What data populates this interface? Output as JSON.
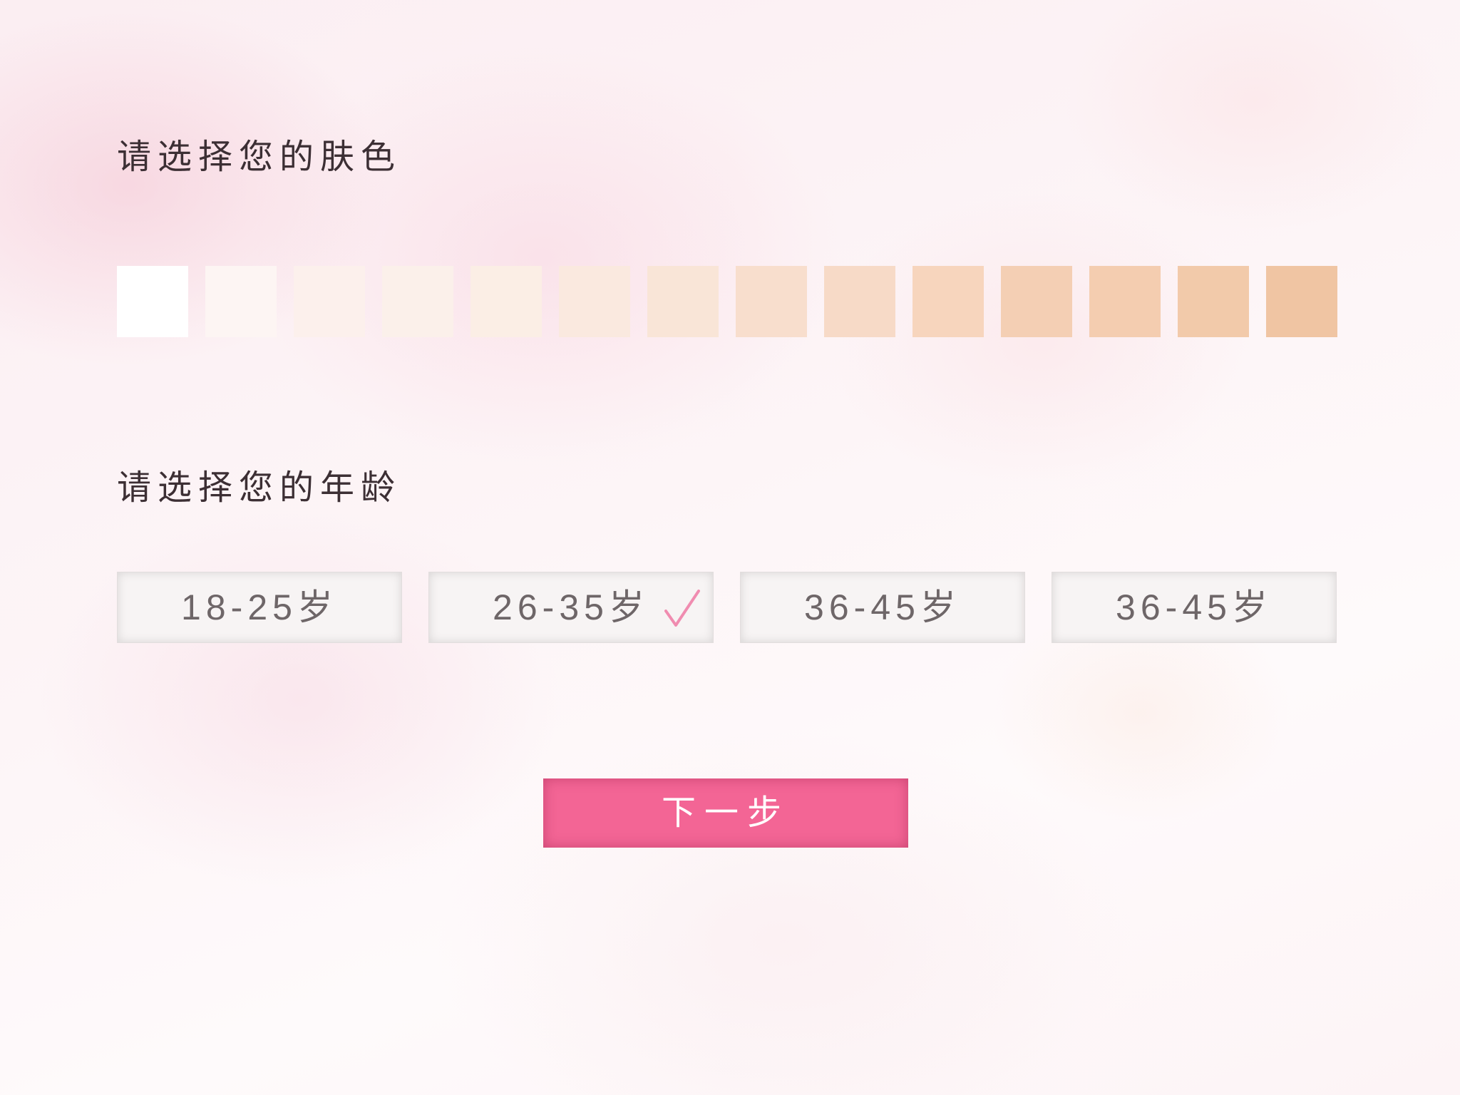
{
  "skin_section": {
    "title": "请选择您的肤色",
    "swatches": [
      "#ffffff",
      "#fdf5f3",
      "#fcf0ec",
      "#fbf0ea",
      "#fbeee5",
      "#fae9df",
      "#f9e5d7",
      "#f8decd",
      "#f7dac7",
      "#f7d5bd",
      "#f4cfb4",
      "#f4cdb0",
      "#f2caaa",
      "#f0c5a3"
    ]
  },
  "age_section": {
    "title": "请选择您的年龄",
    "options": [
      {
        "label": "18-25岁",
        "selected": false
      },
      {
        "label": "26-35岁",
        "selected": true
      },
      {
        "label": "36-45岁",
        "selected": false
      },
      {
        "label": "36-45岁",
        "selected": false
      }
    ],
    "selected_mark": "√"
  },
  "next_button": {
    "label": "下一步",
    "color": "#f36595"
  },
  "colors": {
    "heading_text": "#3c2f34",
    "age_text": "#6e6668",
    "check_mark": "#f08cb0"
  },
  "icons": {
    "check": "check-icon"
  }
}
